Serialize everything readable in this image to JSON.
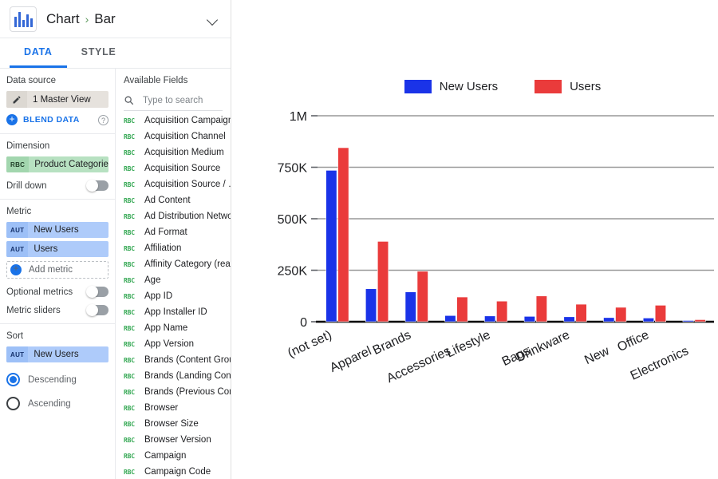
{
  "header": {
    "breadcrumb_root": "Chart",
    "breadcrumb_sep": "›",
    "breadcrumb_current": "Bar",
    "chart_icon": "bar-chart-icon",
    "expand_icon": "chevron-down-icon"
  },
  "tabs": [
    {
      "label": "DATA",
      "active": true
    },
    {
      "label": "STYLE",
      "active": false
    }
  ],
  "left_panel": {
    "data_source": {
      "title": "Data source",
      "value": "1 Master View",
      "edit_icon": "pencil-icon",
      "blend_label": "BLEND DATA",
      "help_icon": "question-mark-icon"
    },
    "dimension": {
      "title": "Dimension",
      "badge": "RBC",
      "value": "Product Categorie…",
      "drill_down_label": "Drill down"
    },
    "metric": {
      "title": "Metric",
      "items": [
        {
          "badge": "AUT",
          "label": "New Users"
        },
        {
          "badge": "AUT",
          "label": "Users"
        }
      ],
      "add_label": "Add metric",
      "optional_label": "Optional metrics",
      "sliders_label": "Metric sliders"
    },
    "sort": {
      "title": "Sort",
      "badge": "AUT",
      "value": "New Users",
      "descending_label": "Descending",
      "ascending_label": "Ascending",
      "selected": "Descending"
    }
  },
  "available_fields": {
    "title": "Available Fields",
    "search_placeholder": "Type to search",
    "search_value": "",
    "search_icon": "search-icon",
    "field_badge": "RBC",
    "items": [
      "Acquisition Campaign",
      "Acquisition Channel",
      "Acquisition Medium",
      "Acquisition Source",
      "Acquisition Source / …",
      "Ad Content",
      "Ad Distribution Netwo…",
      "Ad Format",
      "Affiliation",
      "Affinity Category (reac…",
      "Age",
      "App ID",
      "App Installer ID",
      "App Name",
      "App Version",
      "Brands (Content Group)",
      "Brands (Landing Cont…",
      "Brands (Previous Con…",
      "Browser",
      "Browser Size",
      "Browser Version",
      "Campaign",
      "Campaign Code"
    ]
  },
  "colors": {
    "new_users": "#1a33e8",
    "users": "#ea3b3b",
    "accent": "#1a73e8",
    "dimension_chip": "#b7e1c1",
    "metric_chip": "#aecbfa",
    "gridline": "#999999",
    "axis": "#000000"
  },
  "chart_data": {
    "type": "bar",
    "title": "",
    "xlabel": "",
    "ylabel": "",
    "ylim": [
      0,
      1000000
    ],
    "yticks": [
      0,
      250000,
      500000,
      750000,
      1000000
    ],
    "ytick_labels": [
      "0",
      "250K",
      "500K",
      "750K",
      "1M"
    ],
    "grid": true,
    "legend_position": "top",
    "categories": [
      "(not set)",
      "Apparel",
      "Brands",
      "Accessories",
      "Lifestyle",
      "Bags",
      "Drinkware",
      "New",
      "Office",
      "Electronics"
    ],
    "series": [
      {
        "name": "New Users",
        "color": "#1a33e8",
        "values": [
          735000,
          160000,
          145000,
          30000,
          28000,
          26000,
          24000,
          20000,
          18000,
          6000
        ]
      },
      {
        "name": "Users",
        "color": "#ea3b3b",
        "values": [
          845000,
          390000,
          245000,
          120000,
          100000,
          125000,
          85000,
          70000,
          80000,
          10000
        ]
      }
    ]
  }
}
